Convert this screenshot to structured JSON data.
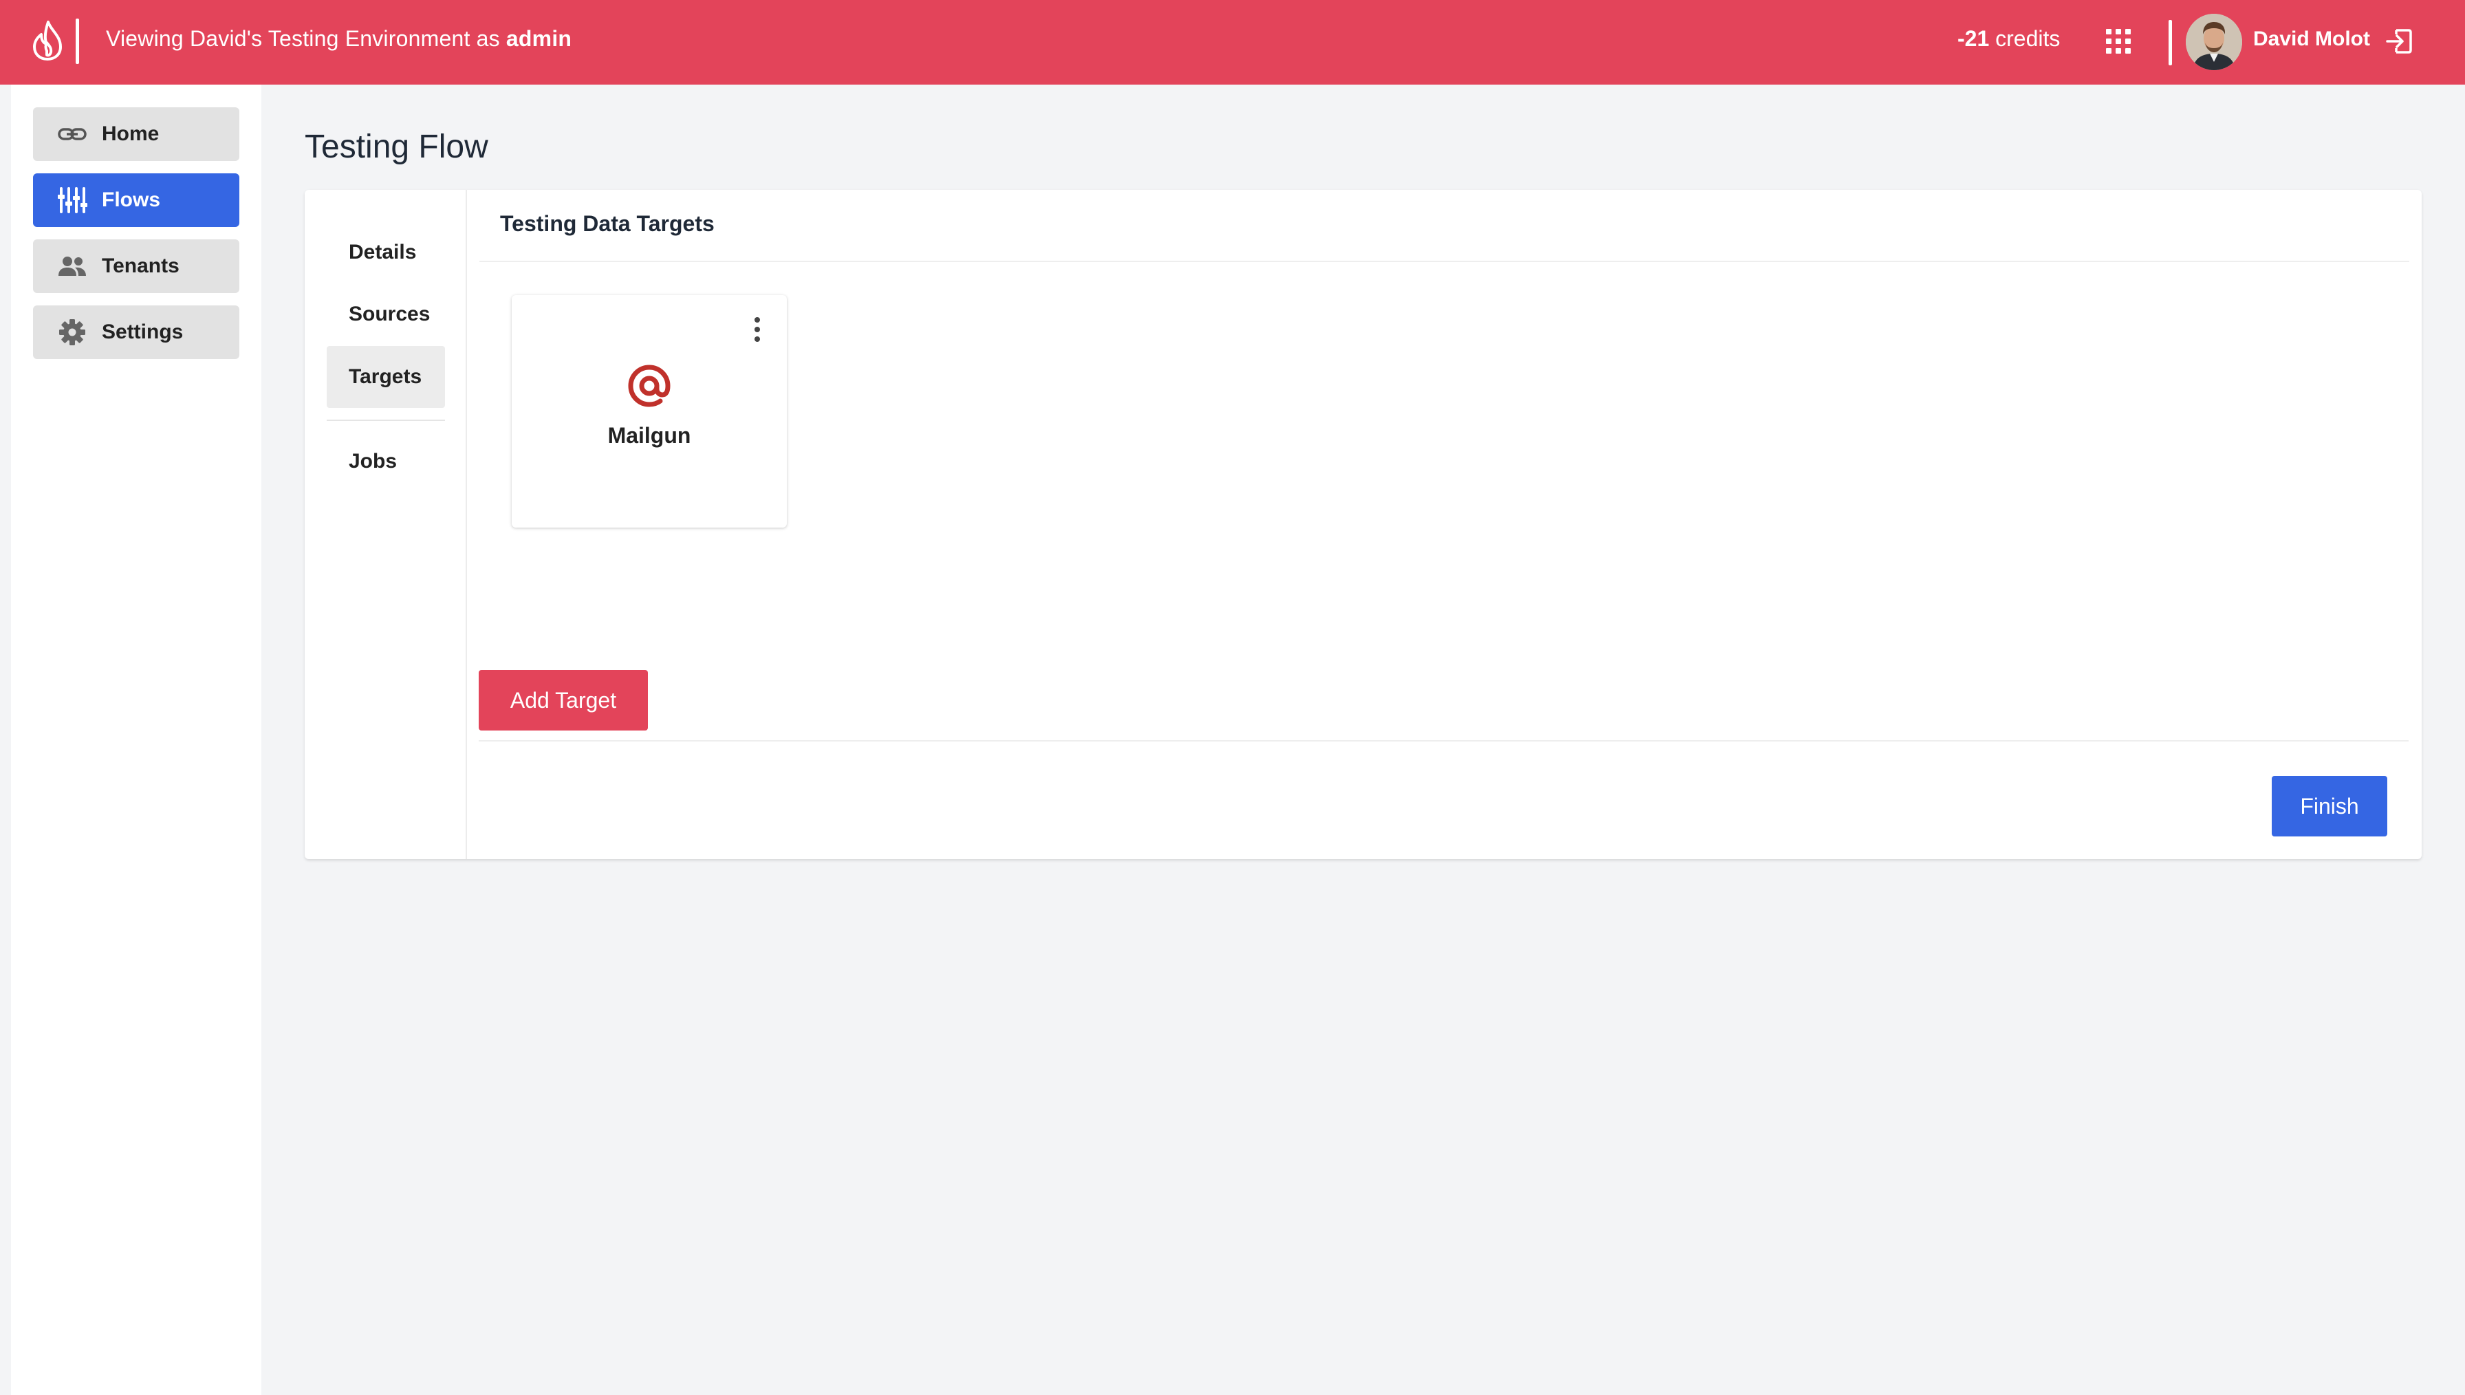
{
  "topbar": {
    "env_prefix": "Viewing David's Testing Environment as ",
    "env_role": "admin",
    "credits_value": "-21",
    "credits_label": " credits",
    "user_name": "David Molot",
    "brand_color": "#e3445a"
  },
  "sidebar": {
    "items": [
      {
        "label": "Home",
        "icon": "link-icon"
      },
      {
        "label": "Flows",
        "icon": "sliders-icon",
        "active": true
      },
      {
        "label": "Tenants",
        "icon": "people-icon"
      },
      {
        "label": "Settings",
        "icon": "gear-icon"
      }
    ],
    "active_color": "#3566e3"
  },
  "page": {
    "title": "Testing Flow"
  },
  "tabs": [
    {
      "label": "Details"
    },
    {
      "label": "Sources"
    },
    {
      "label": "Targets",
      "active": true
    },
    {
      "label": "Jobs"
    }
  ],
  "targets_section": {
    "title": "Testing Data Targets",
    "cards": [
      {
        "name": "Mailgun",
        "icon": "at-sign-icon",
        "icon_color": "#c0312b"
      }
    ],
    "add_button": "Add Target",
    "finish_button": "Finish"
  }
}
